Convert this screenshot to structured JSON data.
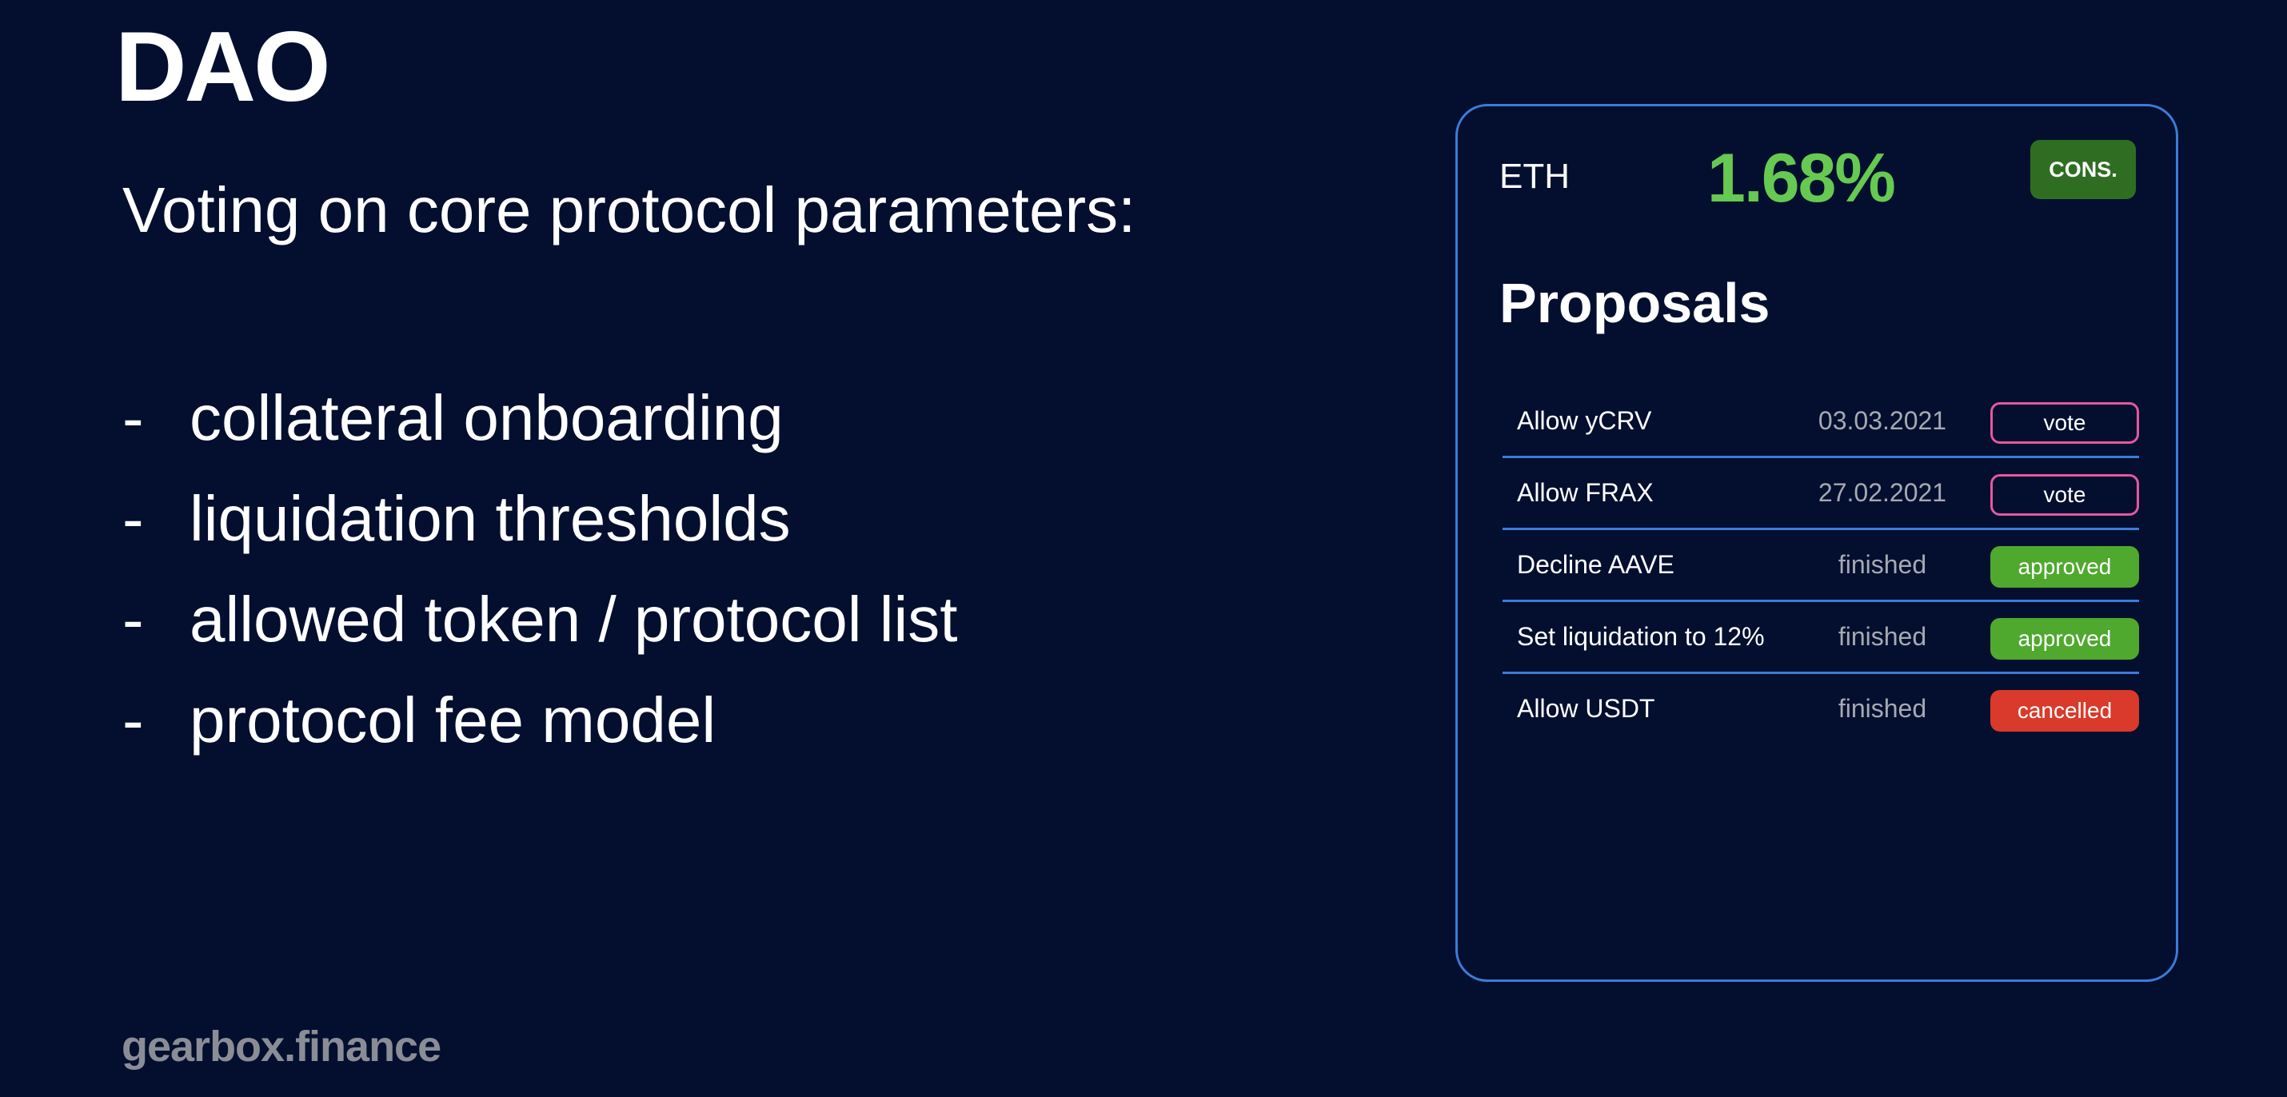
{
  "slide": {
    "title": "DAO",
    "subtitle": "Voting on core protocol parameters:",
    "bullet_marker": "-",
    "bullets": [
      "collateral onboarding",
      "liquidation thresholds",
      "allowed token / protocol list",
      "protocol fee model"
    ],
    "footer": "gearbox.finance"
  },
  "card": {
    "asset": "ETH",
    "rate": "1.68%",
    "badge": "CONS.",
    "heading": "Proposals",
    "proposals": [
      {
        "name": "Allow yCRV",
        "status": "03.03.2021",
        "action": "vote",
        "action_type": "vote"
      },
      {
        "name": "Allow FRAX",
        "status": "27.02.2021",
        "action": "vote",
        "action_type": "vote"
      },
      {
        "name": "Decline AAVE",
        "status": "finished",
        "action": "approved",
        "action_type": "approved"
      },
      {
        "name": "Set liquidation to 12%",
        "status": "finished",
        "action": "approved",
        "action_type": "approved"
      },
      {
        "name": "Allow USDT",
        "status": "finished",
        "action": "cancelled",
        "action_type": "cancelled"
      }
    ]
  },
  "colors": {
    "background": "#040f2f",
    "card_border": "#3d7bd8",
    "rate_green": "#66c952",
    "badge_green": "#2f6e22",
    "vote_pink": "#e2589e",
    "approved_green": "#4fa92e",
    "cancelled_red": "#d93a2b",
    "muted_gray": "#a6a9b1"
  }
}
